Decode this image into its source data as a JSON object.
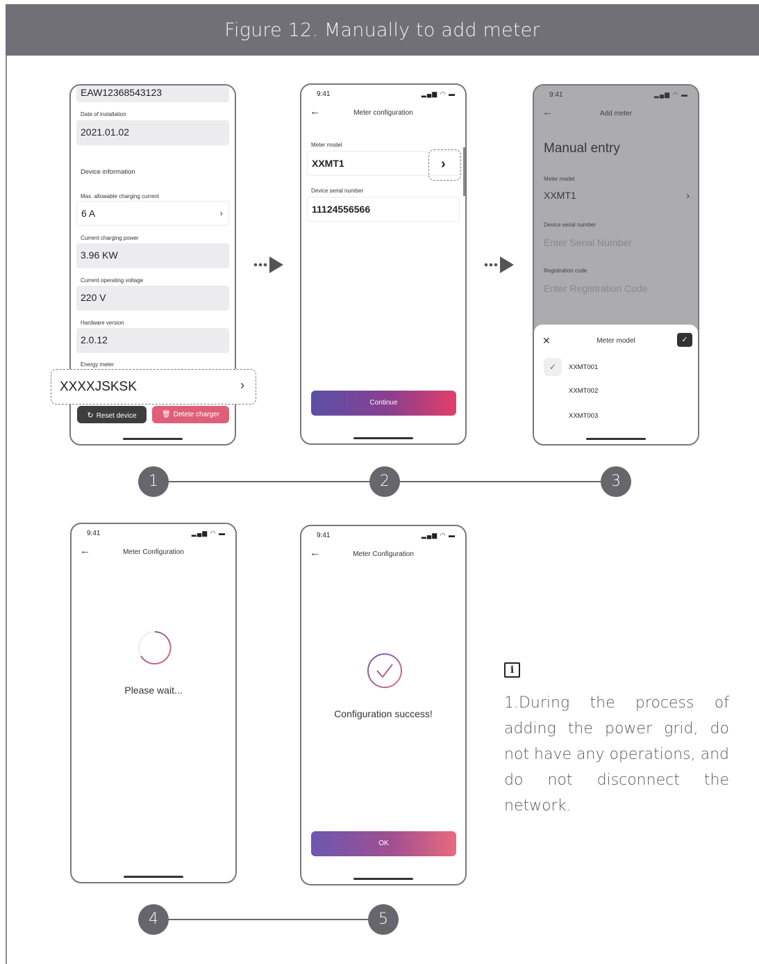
{
  "figure": {
    "title": "Figure 12.  Manually to add meter"
  },
  "phone1": {
    "serial_partial": "EAW12368543123",
    "install_label": "Date of installation",
    "install_value": "2021.01.02",
    "section_label": "Device information",
    "max_current_label": "Max. allowable charging current",
    "max_current_value": "6 A",
    "power_label": "Current charging power",
    "power_value": "3.96 KW",
    "voltage_label": "Current operating voltage",
    "voltage_value": "220 V",
    "hw_label": "Hardware version",
    "hw_value": "2.0.12",
    "meter_label": "Energy meter",
    "meter_value": "XXXXJSKSK",
    "reset_label": "Reset device",
    "delete_label": "Detete charger"
  },
  "phone2": {
    "time": "9:41",
    "title": "Meter configuration",
    "model_label": "Meter model",
    "model_value": "XXMT1",
    "serial_label": "Device serial number",
    "serial_value": "11124556566",
    "continue_label": "Continue"
  },
  "phone3": {
    "time": "9:41",
    "title": "Add meter",
    "heading": "Manual entry",
    "model_label": "Meter model",
    "model_value": "XXMT1",
    "serial_label": "Device serial number",
    "serial_placeholder": "Enter Serial Number",
    "reg_label": "Registration code",
    "reg_placeholder": "Enter Registration Code",
    "sheet_title": "Meter model",
    "options": [
      "XXMT001",
      "XXMT002",
      "XXMT003"
    ],
    "selected_option": "XXMT001"
  },
  "phone4": {
    "time": "9:41",
    "title": "Meter Configuration",
    "wait_text": "Please wait..."
  },
  "phone5": {
    "time": "9:41",
    "title": "Meter Configuration",
    "success_text": "Configuration success!",
    "ok_label": "OK"
  },
  "steps": [
    "1",
    "2",
    "3",
    "4",
    "5"
  ],
  "note": {
    "icon": "i",
    "text": "1.During the process of adding the power grid, do not have any operations, and do not disconnect the network."
  },
  "colors": {
    "header_bg": "#707076",
    "step_bg": "#66666c",
    "gradient_start": "#5b4fa6",
    "gradient_end": "#e23f6a"
  }
}
